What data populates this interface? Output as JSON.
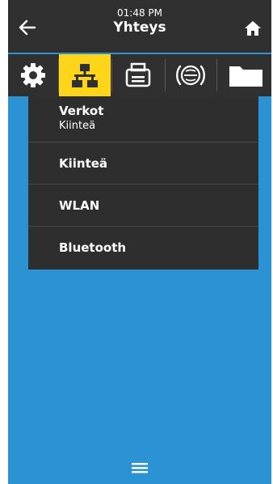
{
  "header": {
    "time": "01:48 PM",
    "title": "Yhteys",
    "back_icon": "arrow-left-icon",
    "home_icon": "home-icon"
  },
  "tabs": [
    {
      "icon": "gear-icon",
      "active": false
    },
    {
      "icon": "network-icon",
      "active": true
    },
    {
      "icon": "printer-icon",
      "active": false
    },
    {
      "icon": "rfid-icon",
      "active": false
    },
    {
      "icon": "folder-icon",
      "active": false
    }
  ],
  "menu": {
    "items": [
      {
        "label": "Verkot",
        "sublabel": "Kiinteä"
      },
      {
        "label": "Kiinteä"
      },
      {
        "label": "WLAN"
      },
      {
        "label": "Bluetooth"
      }
    ]
  },
  "footer": {
    "menu_icon": "hamburger-menu-icon"
  },
  "colors": {
    "background": "#2b92d4",
    "bar": "#303030",
    "active_tab": "#ffd51a",
    "dropdown": "#2e2e2e"
  }
}
